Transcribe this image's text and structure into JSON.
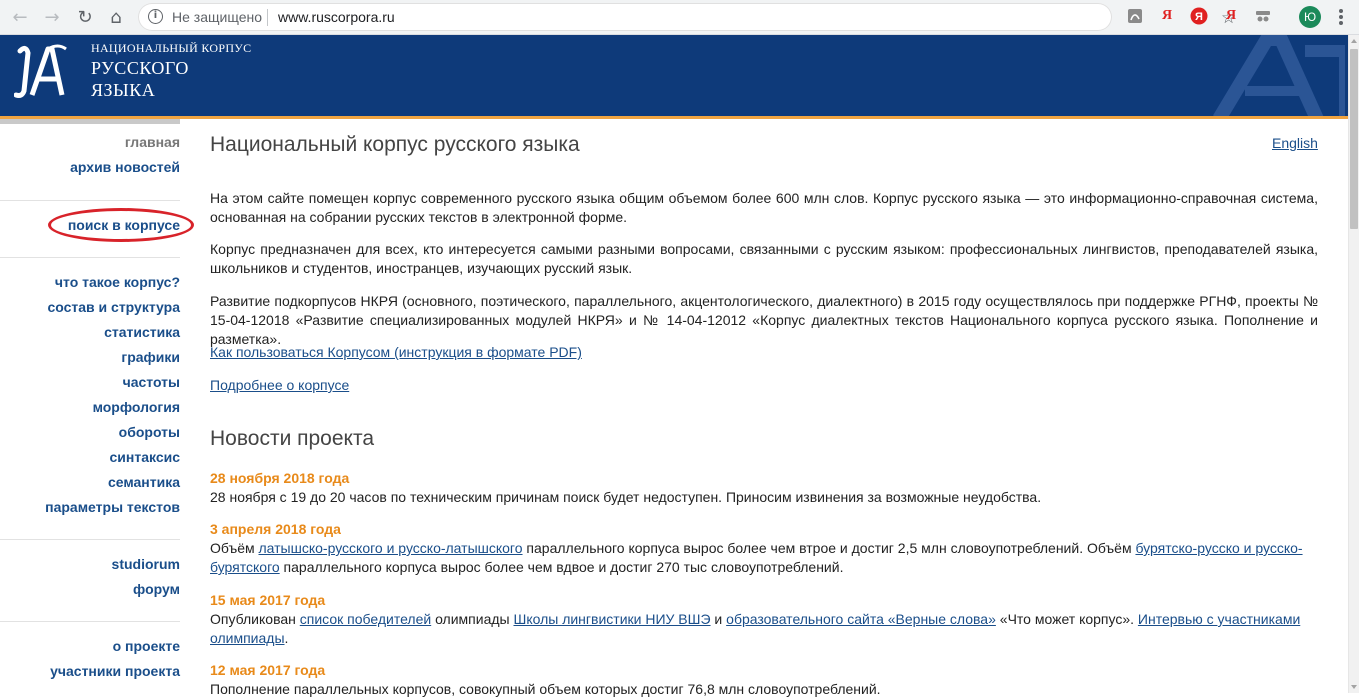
{
  "browser": {
    "security_label": "Не защищено",
    "url": "www.ruscorpora.ru",
    "extensions": [
      "pdf-icon",
      "yandex-icon",
      "yandex-browser-icon",
      "yandex-icon",
      "incognito-icon"
    ],
    "profile_initial": "Ю"
  },
  "site": {
    "logo_line1": "НАЦИОНАЛЬНЫЙ КОРПУС",
    "logo_line2": "РУССКОГО",
    "logo_line3": "ЯЗЫКА",
    "header_color": "#0e3a7a",
    "accent_color": "#f0a441"
  },
  "sidebar": {
    "group1": [
      "главная",
      "архив новостей"
    ],
    "group2": [
      "поиск в корпусе"
    ],
    "group3": [
      "что такое корпус?",
      "состав и структура",
      "статистика",
      "графики",
      "частоты",
      "морфология",
      "обороты",
      "синтаксис",
      "семантика",
      "параметры текстов"
    ],
    "group4": [
      "studiorum",
      "форум"
    ],
    "group5": [
      "о проекте",
      "участники проекта"
    ],
    "highlight_color": "#d8232a"
  },
  "main": {
    "title": "Национальный корпус русского языка",
    "english_link": "English",
    "paragraphs": [
      "На этом сайте помещен корпус современного русского языка общим объемом более 600 млн слов. Корпус русского языка — это информационно-справочная система, основанная на собрании русских текстов в электронной форме.",
      "Корпус предназначен для всех, кто интересуется самыми разными вопросами, связанными с русским языком: профессиональных лингвистов, преподавателей языка, школьников и студентов, иностранцев, изучающих русский язык.",
      "Развитие подкорпусов НКРЯ (основного, поэтического, параллельного, акцентологического, диалектного) в 2015 году осуществлялось при поддержке РГНФ, проекты № 15-04-12018 «Развитие специализированных модулей НКРЯ» и № 14-04-12012 «Корпус диалектных текстов Национального корпуса русского языка. Пополнение и разметка»."
    ],
    "links": [
      "Как пользоваться Корпусом (инструкция в формате PDF)",
      "Подробнее о корпусе"
    ]
  },
  "news": {
    "title": "Новости проекта",
    "items": [
      {
        "date": "28 ноября 2018 года",
        "text": "28 ноября с 19 до 20 часов по техническим причинам поиск будет недоступен. Приносим извинения за возможные неудобства."
      },
      {
        "date": "3 апреля 2018 года",
        "parts": [
          "Объём ",
          "латышско-русского и русско-латышского",
          " параллельного корпуса вырос более чем втрое и достиг 2,5 млн словоупотреблений. Объём ",
          "бурятско-русско и русско-бурятского",
          " параллельного корпуса вырос более чем вдвое и достиг 270 тыс словоупотреблений."
        ]
      },
      {
        "date": "15 мая 2017 года",
        "parts": [
          "Опубликован ",
          "список победителей",
          " олимпиады ",
          "Школы лингвистики НИУ ВШЭ",
          " и ",
          "образовательного сайта «Верные слова»",
          " «Что может корпус». ",
          "Интервью с участниками олимпиады",
          "."
        ]
      },
      {
        "date": "12 мая 2017 года",
        "text": "Пополнение параллельных корпусов, совокупный объем которых достиг 76,8 млн словоупотреблений."
      }
    ]
  }
}
